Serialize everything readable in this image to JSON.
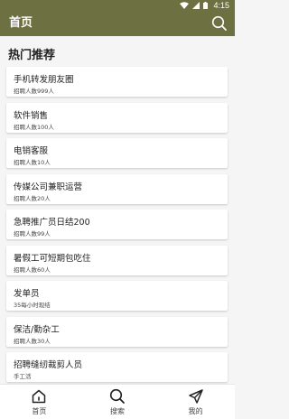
{
  "colors": {
    "primary": "#6d7040",
    "card_bg": "#ffffff",
    "page_bg": "#f5f5f5"
  },
  "status_bar": {
    "time": "4:15"
  },
  "app_bar": {
    "title": "首页",
    "search_icon": "search-icon"
  },
  "section": {
    "title": "热门推荐"
  },
  "jobs": [
    {
      "title": "手机转发朋友圈",
      "subtitle": "招聘人数999人"
    },
    {
      "title": "软件销售",
      "subtitle": "招聘人数100人"
    },
    {
      "title": "电销客服",
      "subtitle": "招聘人数10人"
    },
    {
      "title": "传媒公司兼职运营",
      "subtitle": "招聘人数20人"
    },
    {
      "title": "急聘推广员日结200",
      "subtitle": "招聘人数99人"
    },
    {
      "title": "暑假工可短期包吃住",
      "subtitle": "招聘人数60人"
    },
    {
      "title": "发单员",
      "subtitle": "35每小时现结"
    },
    {
      "title": "保洁/勤杂工",
      "subtitle": "招聘人数30人"
    },
    {
      "title": "招聘缝纫裁剪人员",
      "subtitle": "手工活"
    }
  ],
  "bottom_nav": [
    {
      "label": "首页",
      "icon": "home-icon"
    },
    {
      "label": "搜索",
      "icon": "search-icon"
    },
    {
      "label": "我的",
      "icon": "send-icon"
    }
  ]
}
